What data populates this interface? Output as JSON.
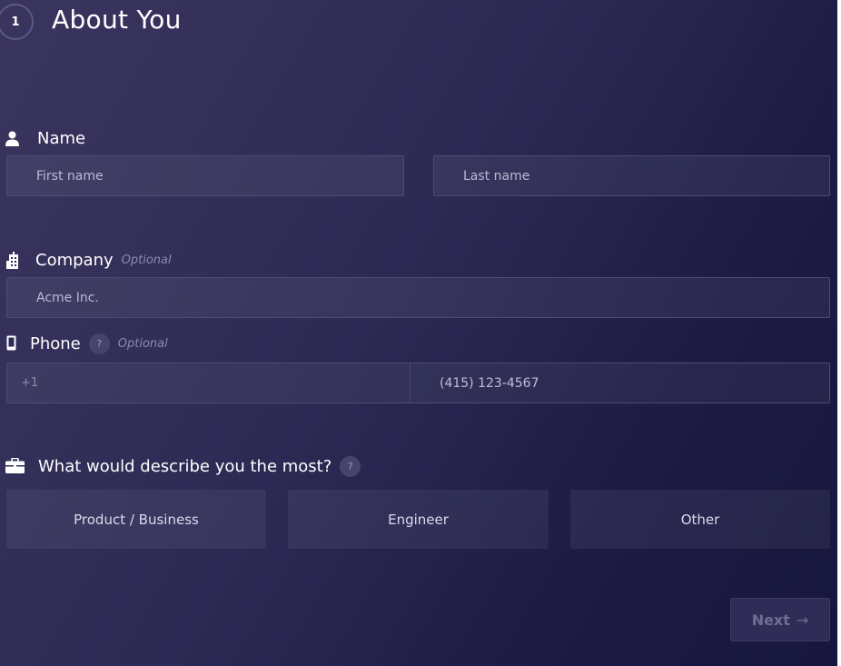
{
  "step": {
    "number": "1",
    "title": "About You"
  },
  "name_section": {
    "label": "Name",
    "icon": "user-icon",
    "first_placeholder": "First name",
    "last_placeholder": "Last name"
  },
  "company_section": {
    "label": "Company",
    "optional": "Optional",
    "icon": "building-icon",
    "placeholder": "Acme Inc."
  },
  "phone_section": {
    "label": "Phone",
    "help": "?",
    "optional": "Optional",
    "icon": "mobile-icon",
    "country_code": "+1",
    "placeholder": "(415) 123-4567"
  },
  "role_section": {
    "label": "What would describe you the most?",
    "help": "?",
    "icon": "briefcase-icon",
    "options": [
      "Product / Business",
      "Engineer",
      "Other"
    ]
  },
  "footer": {
    "next_label": "Next",
    "next_icon": "arrow-right-icon",
    "next_arrow": "→"
  }
}
